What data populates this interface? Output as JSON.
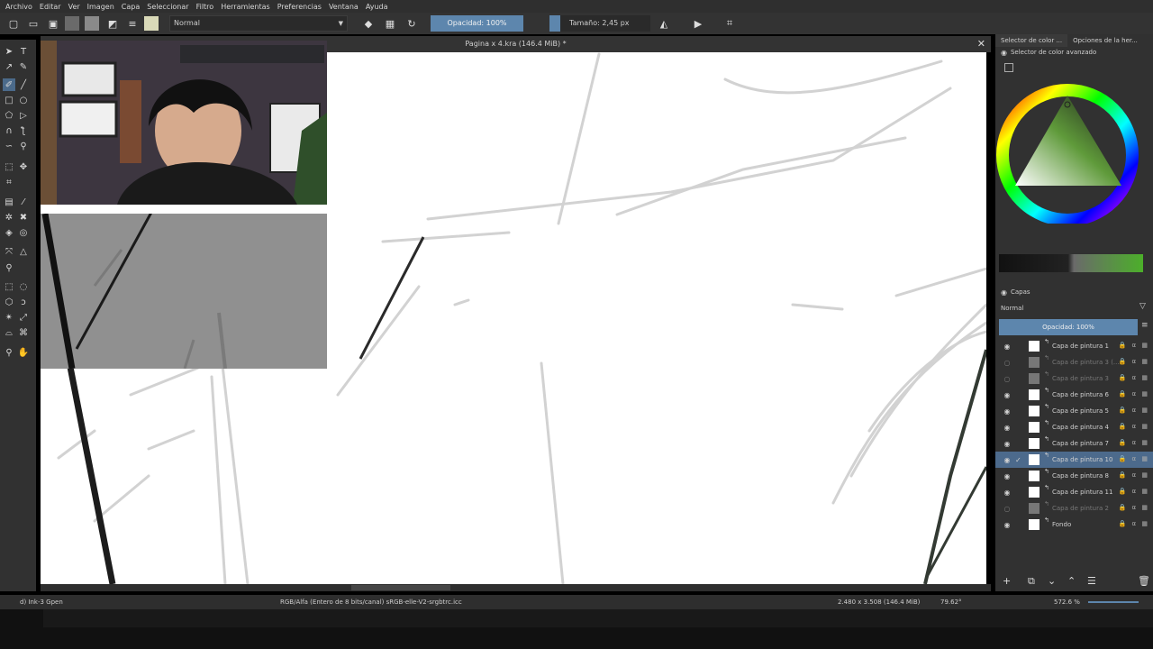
{
  "menu": [
    "Archivo",
    "Editar",
    "Ver",
    "Imagen",
    "Capa",
    "Seleccionar",
    "Filtro",
    "Herramientas",
    "Preferencias",
    "Ventana",
    "Ayuda"
  ],
  "toolbar": {
    "blend_mode": "Normal",
    "opacity_label": "Opacidad: 100%",
    "size_label": "Tamaño: 2,45 px"
  },
  "document": {
    "title": "Pagina x 4.kra (146.4 MiB) *"
  },
  "dock": {
    "tab_color_selector": "Selector de color ...",
    "tab_tool_options": "Opciones de la her...",
    "color_panel_title": "Selector de color avanzado",
    "layers_panel_title": "Capas",
    "layers_blend": "Normal",
    "layers_opacity": "Opacidad:  100%"
  },
  "layers": [
    {
      "name": "Capa de pintura 1",
      "visible": true,
      "active": false
    },
    {
      "name": "Capa de pintura 3 (...",
      "visible": false,
      "active": false
    },
    {
      "name": "Capa de pintura 3",
      "visible": false,
      "active": false
    },
    {
      "name": "Capa de pintura 6",
      "visible": true,
      "active": false
    },
    {
      "name": "Capa de pintura 5",
      "visible": true,
      "active": false
    },
    {
      "name": "Capa de pintura 4",
      "visible": true,
      "active": false
    },
    {
      "name": "Capa de pintura 7",
      "visible": true,
      "active": false
    },
    {
      "name": "Capa de pintura 10",
      "visible": true,
      "active": true
    },
    {
      "name": "Capa de pintura 8",
      "visible": true,
      "active": false
    },
    {
      "name": "Capa de pintura 11",
      "visible": true,
      "active": false
    },
    {
      "name": "Capa de pintura 2",
      "visible": false,
      "active": false
    },
    {
      "name": "Fondo",
      "visible": true,
      "active": false
    }
  ],
  "status": {
    "brush": "d) Ink-3 Gpen",
    "color_space": "RGB/Alfa (Entero de 8 bits/canal)  sRGB-elle-V2-srgbtrc.icc",
    "image_size": "2.480 x 3.508 (146.4 MiB)",
    "rotation": "79.62°",
    "zoom": "572.6 %"
  },
  "colors": {
    "accent": "#5d86ad",
    "panel_bg": "#313131",
    "canvas_bg": "#ffffff"
  }
}
